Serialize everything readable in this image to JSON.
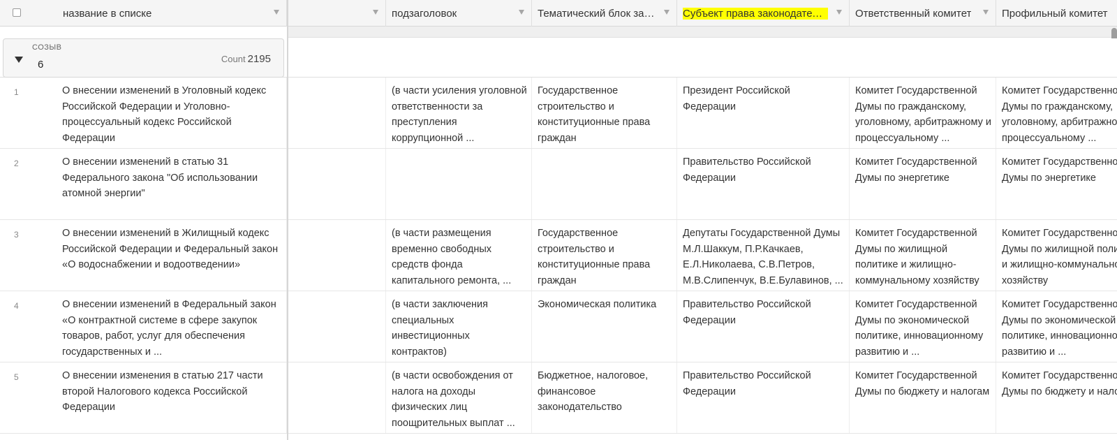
{
  "header": {
    "columns": [
      {
        "label": "название в списке"
      },
      {
        "label": ""
      },
      {
        "label": "подзаголовок"
      },
      {
        "label": "Тематический блок зак..."
      },
      {
        "label": "Субъект права законодатель..."
      },
      {
        "label": "Ответственный комитет"
      },
      {
        "label": "Профильный комитет"
      }
    ]
  },
  "group": {
    "field": "СОЗЫВ",
    "value": "6",
    "count_label": "Count",
    "count": "2195"
  },
  "rows": [
    {
      "num": "1",
      "name": "О внесении изменений в Уголовный кодекс Российской Федерации и Уголовно-процессуальный кодекс Российской Федерации",
      "sub": "(в части усиления уголовной ответственности за преступления коррупционной ...",
      "theme": "Государственное строительство и конституционные права граждан",
      "subject": "Президент Российской Федерации",
      "resp": "Комитет Государственной Думы по гражданскому, уголовному, арбитражному и процессуальному ...",
      "prof": "Комитет Государственной Думы по гражданскому, уголовному, арбитражному и процессуальному ..."
    },
    {
      "num": "2",
      "name": "О внесении изменений в статью 31 Федерального закона \"Об использовании атомной энергии\"",
      "sub": "",
      "theme": "",
      "subject": "Правительство Российской Федерации",
      "resp": "Комитет Государственной Думы по энергетике",
      "prof": "Комитет Государственной Думы по энергетике"
    },
    {
      "num": "3",
      "name": "О внесении изменений в Жилищный кодекс Российской Федерации и Федеральный закон «О водоснабжении и водоотведении»",
      "sub": "(в части размещения временно свободных средств фонда капитального ремонта, ...",
      "theme": "Государственное строительство и конституционные права граждан",
      "subject": "Депутаты Государственной Думы М.Л.Шаккум, П.Р.Качкаев, Е.Л.Николаева, С.В.Петров, М.В.Слипенчук, В.Е.Булавинов, ...",
      "resp": "Комитет Государственной Думы по жилищной политике и жилищно-коммунальному хозяйству",
      "prof": "Комитет Государственной Думы по жилищной политике и жилищно-коммунальному хозяйству"
    },
    {
      "num": "4",
      "name": "О внесении изменений в Федеральный закон «О контрактной системе в сфере закупок товаров, работ, услуг для обеспечения государственных и ...",
      "sub": "(в части заключения специальных инвестиционных контрактов)",
      "theme": "Экономическая политика",
      "subject": "Правительство Российской Федерации",
      "resp": "Комитет Государственной Думы по экономической политике, инновационному развитию и ...",
      "prof": "Комитет Государственной Думы по экономической политике, инновационному развитию и ..."
    },
    {
      "num": "5",
      "name": "О внесении изменения в статью 217 части второй Налогового кодекса Российской Федерации",
      "sub": "(в части освобождения от налога на доходы физических лиц поощрительных выплат ...",
      "theme": "Бюджетное, налоговое, финансовое законодательство",
      "subject": "Правительство Российской Федерации",
      "resp": "Комитет Государственной Думы по бюджету и налогам",
      "prof": "Комитет Государственной Думы по бюджету и налогам"
    }
  ]
}
